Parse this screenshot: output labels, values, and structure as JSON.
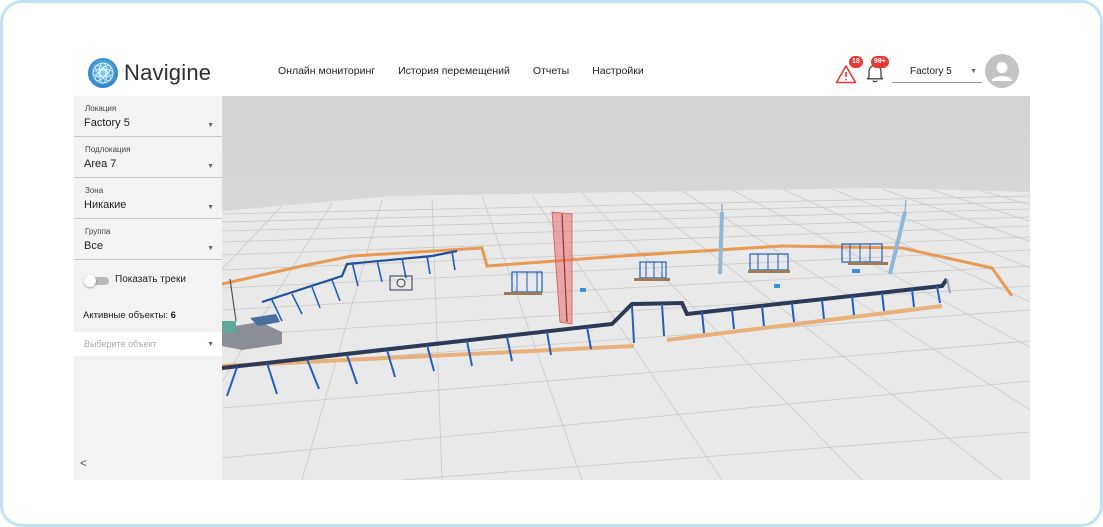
{
  "header": {
    "brand": "Navigine",
    "nav": [
      "Онлайн мониторинг",
      "История перемещений",
      "Отчеты",
      "Настройки"
    ],
    "alerts_badge": "18",
    "notifications_badge": "99+",
    "location_select": "Factory 5"
  },
  "sidebar": {
    "location": {
      "label": "Локация",
      "value": "Factory 5"
    },
    "sublocation": {
      "label": "Подлокация",
      "value": "Area 7"
    },
    "zone": {
      "label": "Зона",
      "value": "Никакие"
    },
    "group": {
      "label": "Группа",
      "value": "Все"
    },
    "show_tracks_label": "Показать треки",
    "show_tracks_enabled": false,
    "active_objects_label": "Активные объекты:",
    "active_objects_count": "6",
    "object_select_placeholder": "Выберите объект",
    "collapse_symbol": "<"
  },
  "colors": {
    "frame_border": "#bfe2f7",
    "badge": "#e53935",
    "conveyor_rail": "#f0a868",
    "conveyor_support": "#1f5fbf",
    "highlight_zone": "#e87070",
    "floor": "#dadada"
  },
  "icons": {
    "logo": "navigine-globe-icon",
    "alerts": "warning-triangle-icon",
    "notifications": "bell-icon",
    "dropdown": "caret-down-icon",
    "user": "user-avatar-icon"
  }
}
